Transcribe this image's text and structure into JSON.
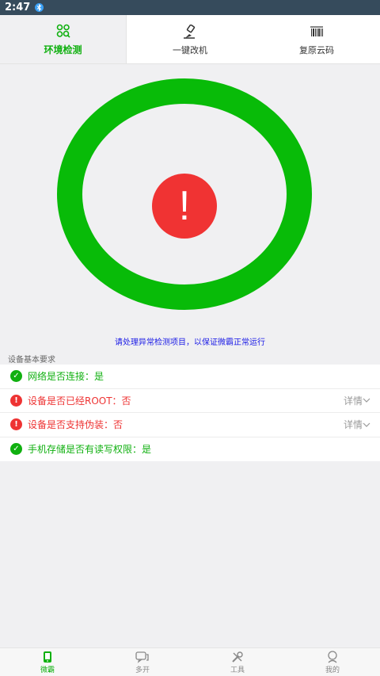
{
  "status_bar": {
    "time": "2:47"
  },
  "tabs": [
    {
      "label": "环境检测",
      "icon": "env-check-icon",
      "active": true
    },
    {
      "label": "一键改机",
      "icon": "brush-icon",
      "active": false
    },
    {
      "label": "复原云码",
      "icon": "barcode-icon",
      "active": false
    }
  ],
  "status_ring": {
    "ring_color": "#08bb08",
    "alert_color": "#f03333",
    "alert_symbol": "!"
  },
  "hint_text": "请处理异常检测项目，以保证微霸正常运行",
  "section_title": "设备基本要求",
  "checks": [
    {
      "label": "网络是否连接：是",
      "status": "ok",
      "detail": ""
    },
    {
      "label": "设备是否已经ROOT：否",
      "status": "bad",
      "detail": "详情"
    },
    {
      "label": "设备是否支持伪装：否",
      "status": "bad",
      "detail": "详情"
    },
    {
      "label": "手机存储是否有读写权限：是",
      "status": "ok",
      "detail": ""
    }
  ],
  "bottom_nav": [
    {
      "label": "微霸",
      "icon": "phone-icon",
      "active": true
    },
    {
      "label": "多开",
      "icon": "chat-icon",
      "active": false
    },
    {
      "label": "工具",
      "icon": "tools-icon",
      "active": false
    },
    {
      "label": "我的",
      "icon": "user-icon",
      "active": false
    }
  ],
  "colors": {
    "accent": "#10b010",
    "error": "#ee3333",
    "hint": "#1a1ae6"
  }
}
